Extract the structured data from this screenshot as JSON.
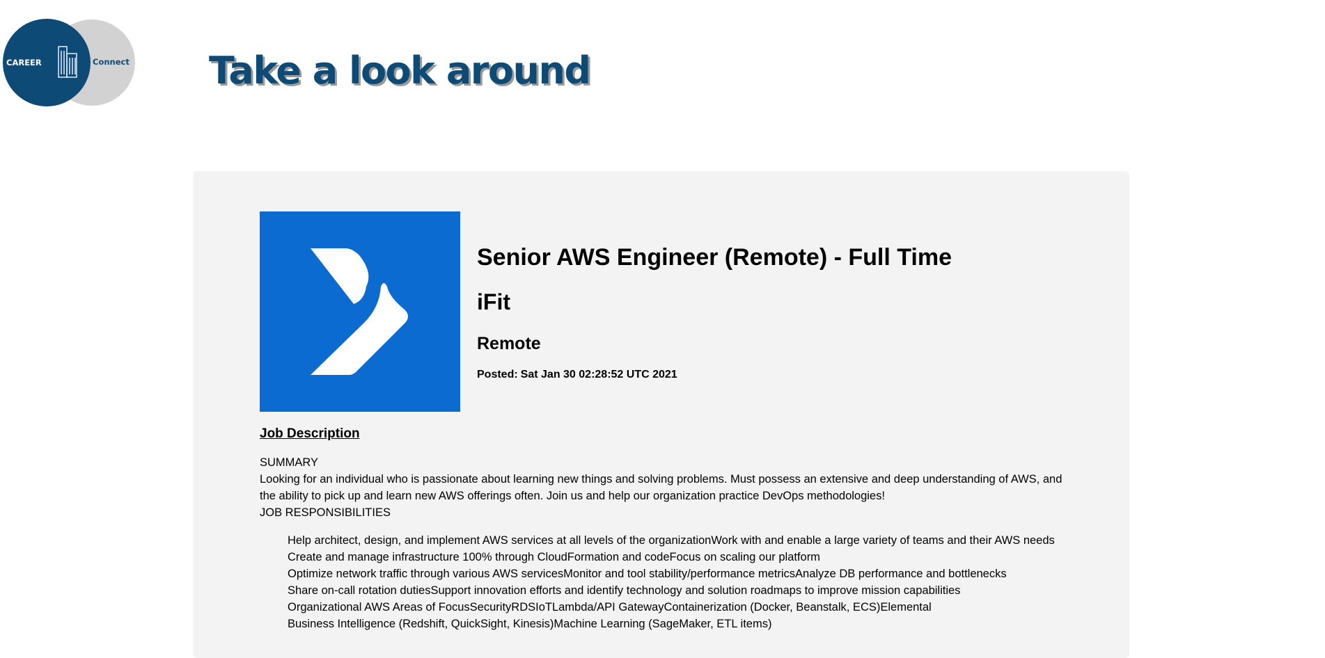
{
  "brand": {
    "logo_text_left": "CAREER",
    "logo_text_right": "Connect",
    "colors": {
      "primary": "#0d4a75",
      "secondary": "#d2d2d2"
    }
  },
  "hero": {
    "title": "Take a look around"
  },
  "job": {
    "company_logo_icon": "chevron-right-icon",
    "company_logo_color": "#0b6bd0",
    "title": "Senior AWS Engineer (Remote) - Full Time",
    "company": "iFit",
    "location": "Remote",
    "posted_label": "Posted:",
    "posted_date": "Sat Jan 30 02:28:52 UTC 2021",
    "description_heading": "Job Description",
    "summary_heading": "SUMMARY",
    "summary_text": "Looking for an individual who is passionate about learning new things and solving problems. Must possess an extensive and deep understanding of AWS, and the ability to pick up and learn new AWS offerings often. Join us and help our organization practice DevOps methodologies!",
    "responsibilities_heading": "JOB RESPONSIBILITIES",
    "responsibilities": [
      "Help architect, design, and implement AWS services at all levels of the organizationWork with and enable a large variety of teams and their AWS needs",
      "Create and manage infrastructure 100% through CloudFormation and codeFocus on scaling our platform",
      "Optimize network traffic through various AWS servicesMonitor and tool stability/performance metricsAnalyze DB performance and bottlenecks",
      "Share on-call rotation dutiesSupport innovation efforts and identify technology and solution roadmaps to improve mission capabilities",
      "Organizational AWS Areas of FocusSecurityRDSIoTLambda/API GatewayContainerization (Docker, Beanstalk, ECS)Elemental",
      "Business Intelligence (Redshift, QuickSight, Kinesis)Machine Learning (SageMaker, ETL items)"
    ]
  }
}
